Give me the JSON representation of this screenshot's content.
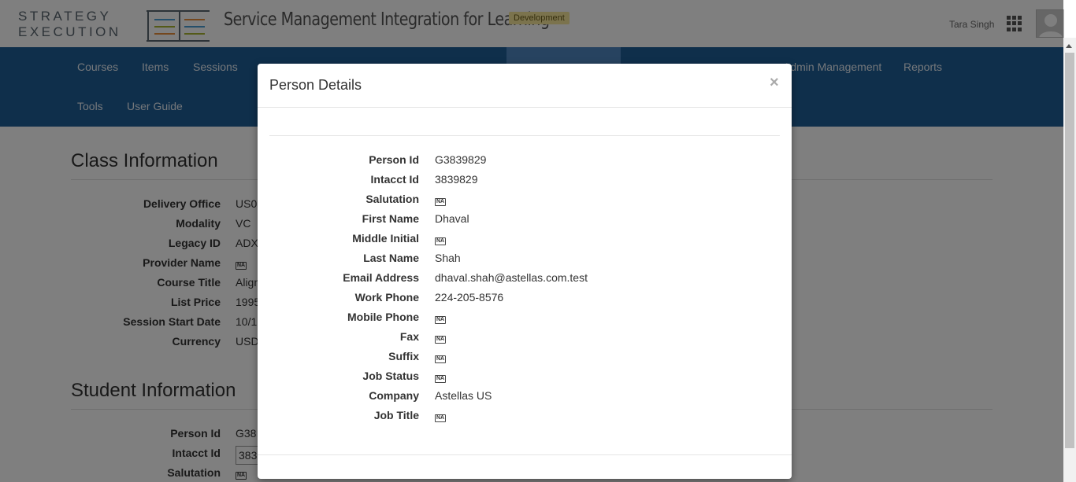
{
  "header": {
    "logo_line1": "STRATEGY",
    "logo_line2": "EXECUTION",
    "app_title": "Service Management Integration for Learning",
    "env_badge": "Development",
    "user_name": "Tara Singh"
  },
  "nav": {
    "items": [
      "Courses",
      "Items",
      "Sessions",
      "Admin Management",
      "Reports",
      "Tools",
      "User Guide"
    ]
  },
  "na_label": "NA",
  "class_info": {
    "title": "Class Information",
    "rows": [
      {
        "label": "Delivery Office",
        "value": "US0"
      },
      {
        "label": "Modality",
        "value": "VC"
      },
      {
        "label": "Legacy ID",
        "value": "ADX"
      },
      {
        "label": "Provider Name",
        "value": null
      },
      {
        "label": "Course Title",
        "value": "Align"
      },
      {
        "label": "List Price",
        "value": "1995"
      },
      {
        "label": "Session Start Date",
        "value": "10/1"
      },
      {
        "label": "Currency",
        "value": "USD"
      }
    ]
  },
  "student_info": {
    "title": "Student Information",
    "rows": [
      {
        "label": "Person Id",
        "value": "G38"
      },
      {
        "label": "Intacct Id",
        "value": "383"
      },
      {
        "label": "Salutation",
        "value": null
      }
    ]
  },
  "modal": {
    "title": "Person Details",
    "close": "×",
    "rows": [
      {
        "label": "Person Id",
        "value": "G3839829"
      },
      {
        "label": "Intacct Id",
        "value": "3839829"
      },
      {
        "label": "Salutation",
        "value": null
      },
      {
        "label": "First Name",
        "value": "Dhaval"
      },
      {
        "label": "Middle Initial",
        "value": null
      },
      {
        "label": "Last Name",
        "value": "Shah"
      },
      {
        "label": "Email Address",
        "value": "dhaval.shah@astellas.com.test"
      },
      {
        "label": "Work Phone",
        "value": "224-205-8576"
      },
      {
        "label": "Mobile Phone",
        "value": null
      },
      {
        "label": "Fax",
        "value": null
      },
      {
        "label": "Suffix",
        "value": null
      },
      {
        "label": "Job Status",
        "value": null
      },
      {
        "label": "Company",
        "value": "Astellas US"
      },
      {
        "label": "Job Title",
        "value": null
      }
    ]
  },
  "colors": {
    "nav_bg": "#1f5f97",
    "badge_bg": "#f6e69b"
  }
}
